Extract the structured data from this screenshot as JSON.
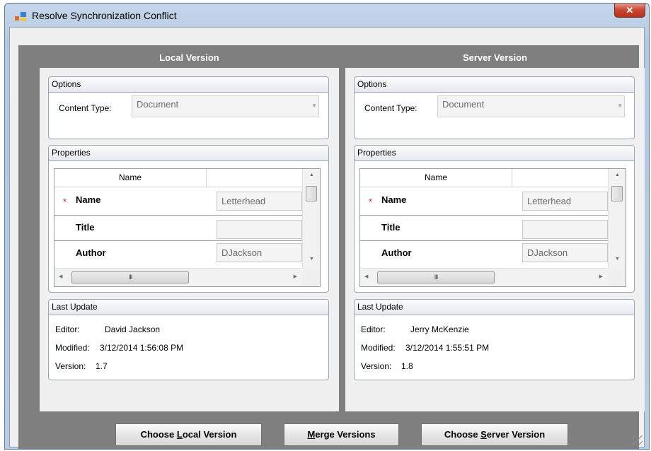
{
  "window": {
    "title": "Resolve Synchronization Conflict",
    "close_glyph": "✕"
  },
  "local": {
    "header": "Local Version",
    "options": {
      "title": "Options",
      "content_type_label": "Content Type:",
      "content_type_value": "Document"
    },
    "properties": {
      "title": "Properties",
      "column_name": "Name",
      "rows": [
        {
          "label": "Name",
          "value": "Letterhead",
          "required": "*"
        },
        {
          "label": "Title",
          "value": ""
        },
        {
          "label": "Author",
          "value": "DJackson"
        }
      ],
      "hscroll_grip": "III"
    },
    "last_update": {
      "title": "Last Update",
      "editor_label": "Editor:",
      "editor": "David Jackson",
      "modified_label": "Modified:",
      "modified": "3/12/2014 1:56:08 PM",
      "version_label": "Version:",
      "version": "1.7"
    }
  },
  "server": {
    "header": "Server Version",
    "options": {
      "title": "Options",
      "content_type_label": "Content Type:",
      "content_type_value": "Document"
    },
    "properties": {
      "title": "Properties",
      "column_name": "Name",
      "rows": [
        {
          "label": "Name",
          "value": "Letterhead",
          "required": "*"
        },
        {
          "label": "Title",
          "value": ""
        },
        {
          "label": "Author",
          "value": "DJackson"
        }
      ],
      "hscroll_grip": "III"
    },
    "last_update": {
      "title": "Last Update",
      "editor_label": "Editor:",
      "editor": "Jerry McKenzie",
      "modified_label": "Modified:",
      "modified": "3/12/2014 1:55:51 PM",
      "version_label": "Version:",
      "version": "1.8"
    }
  },
  "buttons": {
    "choose_local": {
      "pre": "Choose ",
      "mnemonic": "L",
      "post": "ocal Version"
    },
    "merge": {
      "pre": "",
      "mnemonic": "M",
      "post": "erge Versions"
    },
    "choose_server": {
      "pre": "Choose ",
      "mnemonic": "S",
      "post": "erver Version"
    }
  },
  "colors": {
    "panel_dark": "#7f7f7f",
    "panel_light": "#f0f0f0",
    "required_star": "#d03030",
    "close_button": "#c94a36"
  },
  "icons": {
    "app": "app-window-icon",
    "close": "close-icon"
  }
}
